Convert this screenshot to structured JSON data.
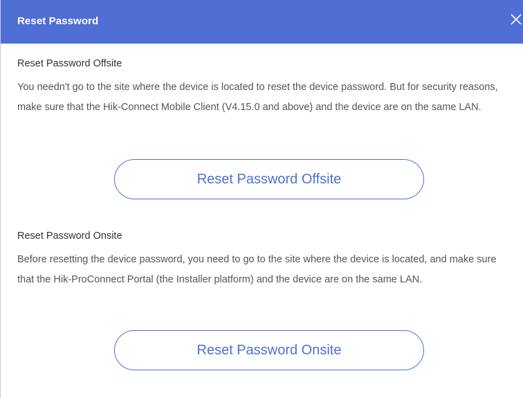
{
  "dialog": {
    "title": "Reset Password",
    "close_icon": "close-icon"
  },
  "offsite": {
    "heading": "Reset Password Offsite",
    "description": "You needn't go to the site where the device is located to reset the device password. But for security reasons, make sure that the Hik-Connect Mobile Client (V4.15.0 and above) and the device are on the same LAN.",
    "button_label": "Reset Password Offsite"
  },
  "onsite": {
    "heading": "Reset Password Onsite",
    "description": "Before resetting the device password, you need to go to the site where the device is located, and make sure that the Hik-ProConnect Portal (the Installer platform) and the device are on the same LAN.",
    "button_label": "Reset Password Onsite"
  },
  "colors": {
    "accent": "#4f6fd4",
    "text": "#333333",
    "description": "#555555"
  }
}
